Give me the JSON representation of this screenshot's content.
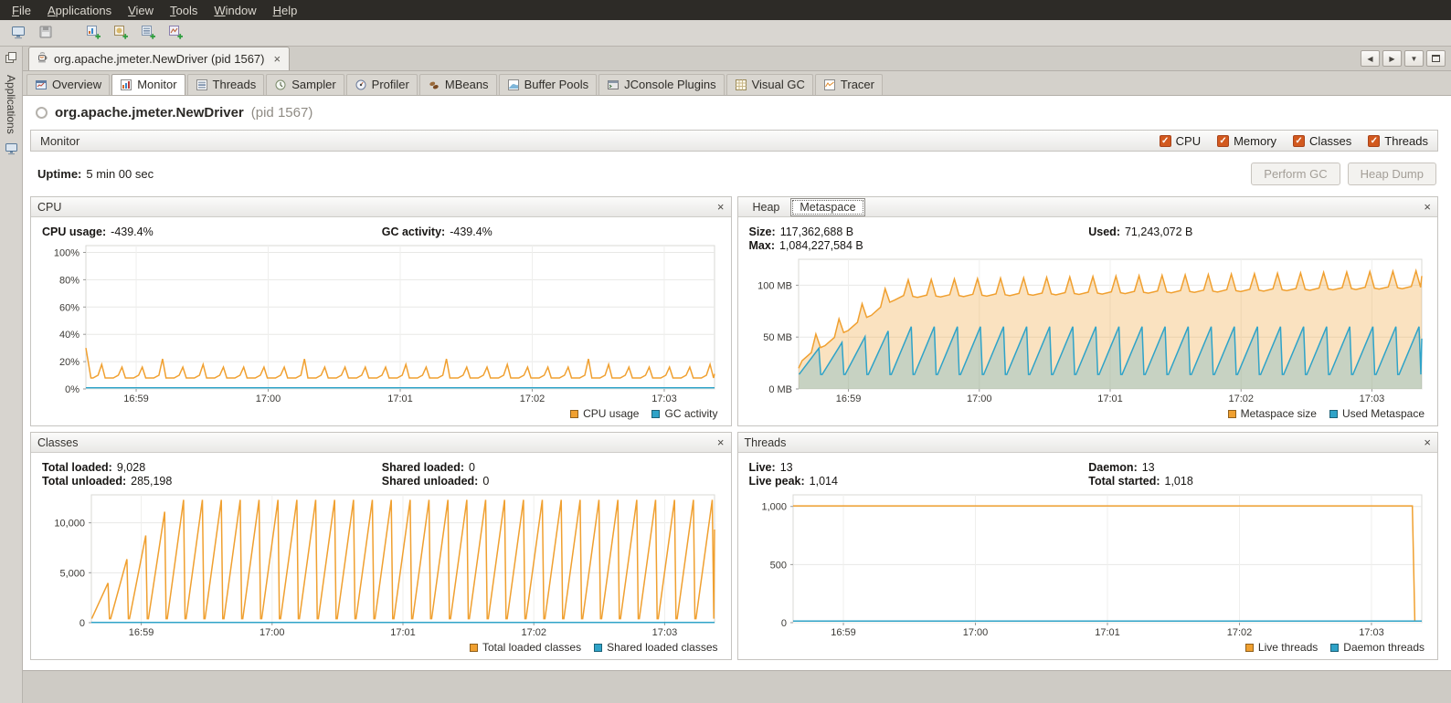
{
  "ui": {
    "close_glyph": "×",
    "check_glyph": "✓"
  },
  "menubar": {
    "items": [
      "File",
      "Applications",
      "View",
      "Tools",
      "Window",
      "Help"
    ]
  },
  "toolbar": {
    "buttons": [
      "open-file",
      "save-all",
      "add-application-snapshot",
      "add-heap-dump",
      "add-thread-dump",
      "add-core-dump"
    ]
  },
  "side_rail": {
    "label": "Applications"
  },
  "doc_tab": {
    "title": "org.apache.jmeter.NewDriver (pid 1567)"
  },
  "nav_buttons": [
    {
      "name": "scroll-left",
      "glyph": "◀"
    },
    {
      "name": "scroll-right",
      "glyph": "▶"
    },
    {
      "name": "tab-list",
      "glyph": "▼"
    }
  ],
  "subtabs": [
    {
      "label": "Overview",
      "selected": false
    },
    {
      "label": "Monitor",
      "selected": true
    },
    {
      "label": "Threads",
      "selected": false
    },
    {
      "label": "Sampler",
      "selected": false
    },
    {
      "label": "Profiler",
      "selected": false
    },
    {
      "label": "MBeans",
      "selected": false
    },
    {
      "label": "Buffer Pools",
      "selected": false
    },
    {
      "label": "JConsole Plugins",
      "selected": false
    },
    {
      "label": "Visual GC",
      "selected": false
    },
    {
      "label": "Tracer",
      "selected": false
    }
  ],
  "header": {
    "title": "org.apache.jmeter.NewDriver",
    "pid": "(pid 1567)"
  },
  "monitor_bar": {
    "title": "Monitor",
    "checkboxes": [
      {
        "label": "CPU",
        "checked": true
      },
      {
        "label": "Memory",
        "checked": true
      },
      {
        "label": "Classes",
        "checked": true
      },
      {
        "label": "Threads",
        "checked": true
      }
    ]
  },
  "uptime": {
    "label": "Uptime:",
    "value": "5 min 00 sec"
  },
  "actions": {
    "perform_gc": "Perform GC",
    "heap_dump": "Heap Dump",
    "enabled": false
  },
  "panels": {
    "cpu": {
      "title": "CPU",
      "stat_cols": [
        [
          {
            "label": "CPU usage:",
            "value": "-439.4%"
          }
        ],
        [
          {
            "label": "GC activity:",
            "value": "-439.4%"
          }
        ]
      ]
    },
    "memory": {
      "tabs": [
        {
          "label": "Heap",
          "selected": false
        },
        {
          "label": "Metaspace",
          "selected": true
        }
      ],
      "stat_cols": [
        [
          {
            "label": "Size:",
            "value": "117,362,688 B"
          },
          {
            "label": "Max:",
            "value": "1,084,227,584 B"
          }
        ],
        [
          {
            "label": "Used:",
            "value": "71,243,072 B"
          }
        ]
      ]
    },
    "classes": {
      "title": "Classes",
      "stat_cols": [
        [
          {
            "label": "Total loaded:",
            "value": "9,028"
          },
          {
            "label": "Total unloaded:",
            "value": "285,198"
          }
        ],
        [
          {
            "label": "Shared loaded:",
            "value": "0"
          },
          {
            "label": "Shared unloaded:",
            "value": "0"
          }
        ]
      ]
    },
    "threads": {
      "title": "Threads",
      "stat_cols": [
        [
          {
            "label": "Live:",
            "value": "13"
          },
          {
            "label": "Live peak:",
            "value": "1,014"
          }
        ],
        [
          {
            "label": "Daemon:",
            "value": "13"
          },
          {
            "label": "Total started:",
            "value": "1,018"
          }
        ]
      ]
    }
  },
  "colors": {
    "accent_orange": "#f0a030",
    "accent_blue": "#2fa3c8",
    "checkbox_orange": "#d2591e"
  },
  "icons": [
    "java-app-icon",
    "overview-icon",
    "monitor-icon",
    "threads-icon",
    "sampler-icon",
    "profiler-icon",
    "mbeans-icon",
    "buffer-pools-icon",
    "jconsole-plugins-icon",
    "visual-gc-icon",
    "tracer-icon",
    "close-icon",
    "maximize-icon"
  ],
  "chart_data": [
    {
      "id": "cpu",
      "type": "line",
      "title": "CPU history",
      "ymax": 105,
      "mleft": 50,
      "height": 170,
      "yticks": [
        {
          "v": 0,
          "label": "0%"
        },
        {
          "v": 20,
          "label": "20%"
        },
        {
          "v": 40,
          "label": "40%"
        },
        {
          "v": 60,
          "label": "60%"
        },
        {
          "v": 80,
          "label": "80%"
        },
        {
          "v": 100,
          "label": "100%"
        }
      ],
      "xticks": [
        {
          "pos": 0.08,
          "label": "16:59"
        },
        {
          "pos": 0.29,
          "label": "17:00"
        },
        {
          "pos": 0.5,
          "label": "17:01"
        },
        {
          "pos": 0.71,
          "label": "17:02"
        },
        {
          "pos": 0.92,
          "label": "17:03"
        }
      ],
      "series": [
        {
          "name": "CPU usage",
          "color": "#f0a030",
          "pattern": {
            "type": "spikes",
            "base": 8,
            "peak": 16,
            "cycles": 31,
            "first": 30
          }
        },
        {
          "name": "GC activity",
          "color": "#2fa3c8",
          "pattern": {
            "type": "flat",
            "value": 0.8
          }
        }
      ]
    },
    {
      "id": "memory",
      "type": "area",
      "title": "Metaspace history",
      "ymax": 125,
      "mleft": 56,
      "height": 160,
      "yticks": [
        {
          "v": 0,
          "label": "0 MB"
        },
        {
          "v": 50,
          "label": "50 MB"
        },
        {
          "v": 100,
          "label": "100 MB"
        }
      ],
      "xticks": [
        {
          "pos": 0.08,
          "label": "16:59"
        },
        {
          "pos": 0.29,
          "label": "17:00"
        },
        {
          "pos": 0.5,
          "label": "17:01"
        },
        {
          "pos": 0.71,
          "label": "17:02"
        },
        {
          "pos": 0.92,
          "label": "17:03"
        }
      ],
      "series": [
        {
          "name": "Metaspace size",
          "color": "#f0a030",
          "fill": true,
          "fill_opacity": 0.3,
          "pattern": {
            "type": "ramp_spikes",
            "ramp_from": 25,
            "ramp_to": 88,
            "ramp_until": 0.16,
            "end": 97,
            "spike": 17,
            "cycles": 27
          }
        },
        {
          "name": "Used Metaspace",
          "color": "#2fa3c8",
          "fill": true,
          "fill_opacity": 0.25,
          "pattern": {
            "type": "sawtooth",
            "min": 14,
            "max": 60,
            "cycles": 27,
            "ramp0": 0.55,
            "ramp_step": 0.12
          }
        }
      ]
    },
    {
      "id": "classes",
      "type": "line",
      "title": "Classes history",
      "ymax": 12800,
      "mleft": 56,
      "height": 160,
      "yticks": [
        {
          "v": 0,
          "label": "0"
        },
        {
          "v": 5000,
          "label": "5,000"
        },
        {
          "v": 10000,
          "label": "10,000"
        }
      ],
      "xticks": [
        {
          "pos": 0.08,
          "label": "16:59"
        },
        {
          "pos": 0.29,
          "label": "17:00"
        },
        {
          "pos": 0.5,
          "label": "17:01"
        },
        {
          "pos": 0.71,
          "label": "17:02"
        },
        {
          "pos": 0.92,
          "label": "17:03"
        }
      ],
      "series": [
        {
          "name": "Total loaded classes",
          "color": "#f0a030",
          "pattern": {
            "type": "sawtooth",
            "min": 400,
            "max": 12300,
            "cycles": 33,
            "ramp0": 0.3,
            "ramp_step": 0.2
          }
        },
        {
          "name": "Shared loaded classes",
          "color": "#2fa3c8",
          "pattern": {
            "type": "flat",
            "value": 25
          }
        }
      ]
    },
    {
      "id": "threads",
      "type": "line",
      "title": "Threads history",
      "ymax": 1100,
      "mleft": 50,
      "height": 160,
      "yticks": [
        {
          "v": 0,
          "label": "0"
        },
        {
          "v": 500,
          "label": "500"
        },
        {
          "v": 1000,
          "label": "1,000"
        }
      ],
      "xticks": [
        {
          "pos": 0.08,
          "label": "16:59"
        },
        {
          "pos": 0.29,
          "label": "17:00"
        },
        {
          "pos": 0.5,
          "label": "17:01"
        },
        {
          "pos": 0.71,
          "label": "17:02"
        },
        {
          "pos": 0.92,
          "label": "17:03"
        }
      ],
      "series": [
        {
          "name": "Live threads",
          "color": "#f0a030",
          "pattern": {
            "type": "flat_drop",
            "value": 1005,
            "drop_at": 0.985,
            "end_value": 13
          }
        },
        {
          "name": "Daemon threads",
          "color": "#2fa3c8",
          "pattern": {
            "type": "flat",
            "value": 13
          }
        }
      ]
    }
  ]
}
